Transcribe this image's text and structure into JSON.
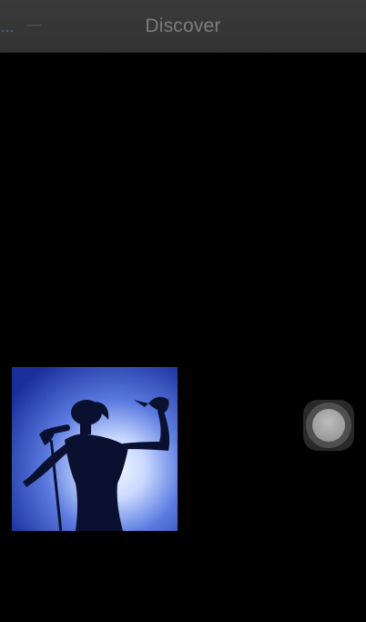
{
  "nav": {
    "title": "Discover"
  },
  "content": {
    "image": {
      "icon": "performer-silhouette-photo",
      "colors": {
        "backdrop": "#1f3aa8",
        "glow": "#eef4ff",
        "silhouette": "#0a1030"
      }
    }
  },
  "assistive_touch": {
    "icon": "assistive-touch-icon"
  }
}
